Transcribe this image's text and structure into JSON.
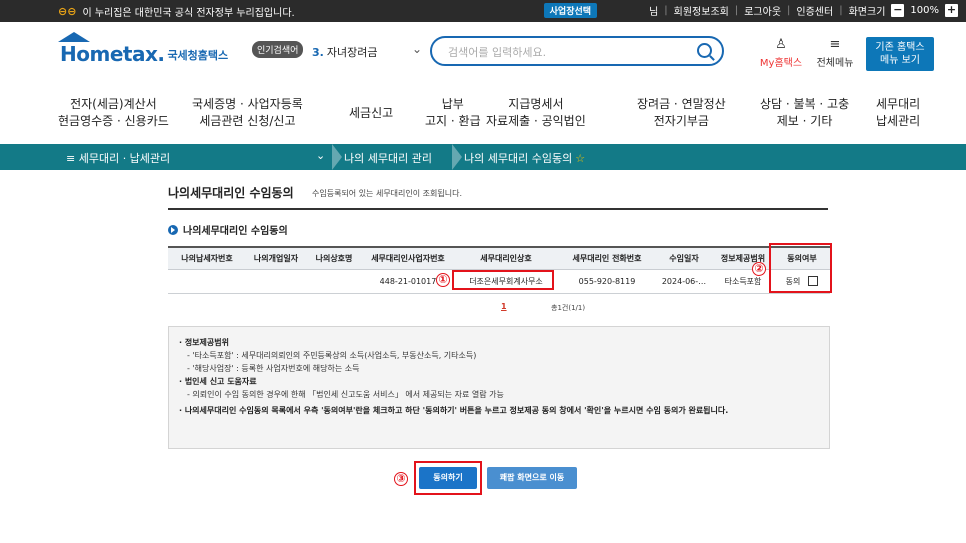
{
  "gov_bar": {
    "notice": "이 누리집은 대한민국 공식 전자정부 누리집입니다.",
    "biz_select": "사업장선택",
    "user_suffix": "님",
    "member_info": "회원정보조회",
    "logout": "로그아웃",
    "cert_center": "인증센터",
    "screen_size": "화면크기",
    "zoom_level": "100%",
    "zoom_minus": "−",
    "zoom_plus": "+"
  },
  "header": {
    "logo_text": "Hometax.",
    "logo_kr": "국세청홈택스",
    "popular_label": "인기검색어",
    "popular_rank": "3.",
    "popular_term": "자녀장려금",
    "search_placeholder": "검색어를 입력하세요.",
    "my_hometax": "My홈택스",
    "all_menu": "전체메뉴",
    "old_menu_line1": "기존 홈택스",
    "old_menu_line2": "메뉴 보기"
  },
  "nav": [
    {
      "l1": "전자(세금)계산서",
      "l2": "현금영수증 · 신용카드"
    },
    {
      "l1": "국세증명 · 사업자등록",
      "l2": "세금관련 신청/신고"
    },
    {
      "l1": "세금신고",
      "l2": ""
    },
    {
      "l1": "납부",
      "l2": "고지 · 환급"
    },
    {
      "l1": "지급명세서",
      "l2": "자료제출 · 공익법인"
    },
    {
      "l1": "장려금 · 연말정산",
      "l2": "전자기부금"
    },
    {
      "l1": "상담 · 불복 · 고충",
      "l2": "제보 · 기타"
    },
    {
      "l1": "세무대리",
      "l2": "납세관리"
    }
  ],
  "breadcrumb": {
    "menu": "≡  세무대리 · 납세관리",
    "level1": "나의 세무대리 관리",
    "level2": "나의 세무대리 수임동의"
  },
  "page": {
    "title": "나의세무대리인 수임동의",
    "desc": "수임등록되어 있는 세무대리인이 조회됩니다.",
    "section": "나의세무대리인 수임동의"
  },
  "table": {
    "headers": [
      "나의납세자번호",
      "나의개업일자",
      "나의상호명",
      "세무대리인사업자번호",
      "세무대리인상호",
      "세무대리인 전화번호",
      "수임일자",
      "정보제공범위",
      "동의여부"
    ],
    "rows": [
      [
        "",
        "",
        "",
        "448-21-01017",
        "더조은세무회계사무소",
        "055-920-8119",
        "2024-06-…",
        "타소득포함",
        "동의"
      ]
    ]
  },
  "pager": {
    "page": "1",
    "total": "총1건(1/1)"
  },
  "info": {
    "h1": "· 정보제공범위",
    "l1": "- '타소득포함' : 세무대리의뢰인의 주민등록상의 소득(사업소득, 부동산소득, 기타소득)",
    "l2": "- '해당사업장' : 등록한 사업자번호에 해당하는 소득",
    "h2": "· 법인세 신고 도움자료",
    "l3": "- 의뢰인이 수임 동의한 경우에 한해 「법인세 신고도움 서비스」 에서 제공되는 자료 열람 가능",
    "h3": "· 나의세무대리인 수임동의 목록에서 우측 '동의여부'란을 체크하고 하단 '동의하기' 버튼을 누르고 정보제공 동의 창에서 '확인'을 누르시면 수임 동의가 완료됩니다."
  },
  "buttons": {
    "agree": "동의하기",
    "back": "쾌팝 화면으로 이동"
  },
  "markers": [
    "①",
    "②",
    "③"
  ],
  "colors": {
    "teal_bar": "#137a87",
    "brand_blue": "#1868b2",
    "highlight_red": "#e3131b",
    "button_blue": "#1b74c8"
  }
}
